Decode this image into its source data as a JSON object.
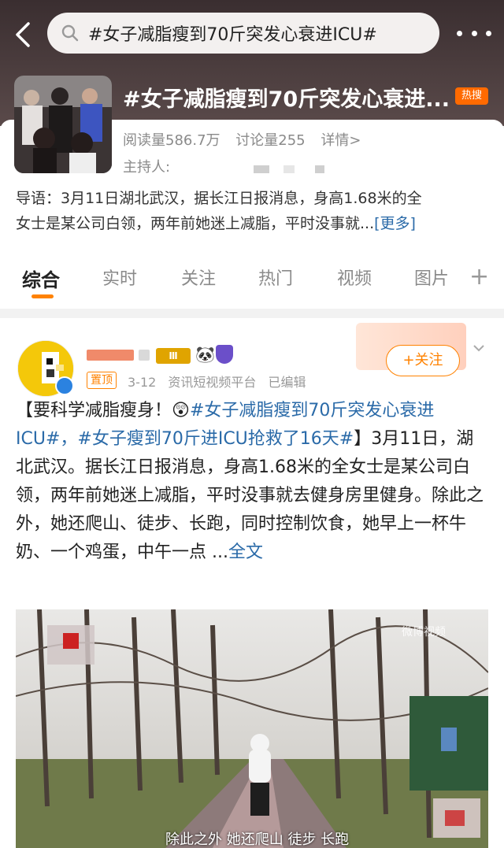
{
  "search": {
    "query": "#女子减脂瘦到70斤突发心衰进ICU#"
  },
  "topic": {
    "title": "#女子减脂瘦到70斤突发心衰进...",
    "hot_badge": "热搜",
    "read_count": "阅读量586.7万",
    "discussion_count": "讨论量255",
    "detail_link": "详情>",
    "host_label": "主持人:",
    "intro_line1": "导语：3月11日湖北武汉，据长江日报消息，身高1.68米的全",
    "intro_line2": "女士是某公司白领，两年前她迷上减脂，平时没事就...",
    "intro_more": "[更多]"
  },
  "tabs": [
    {
      "label": "综合"
    },
    {
      "label": "实时"
    },
    {
      "label": "关注"
    },
    {
      "label": "热门"
    },
    {
      "label": "视频"
    },
    {
      "label": "图片"
    }
  ],
  "post": {
    "level_badge": "Ⅲ",
    "pinned": "置顶",
    "date": "3-12",
    "source": "资讯短视频平台",
    "edited": "已编辑",
    "follow_label": "+关注",
    "text_prefix": "【要科学减脂瘦身！",
    "tag1": "#女子减脂瘦到70斤突发心衰进ICU#",
    "sep": "，",
    "tag2": "#女子瘦到70斤进ICU抢救了16天#",
    "text_body": "】3月11日，湖北武汉。据长江日报消息，身高1.68米的全女士是某公司白领，两年前她迷上减脂，平时没事就去健身房里健身。除此之外，她还爬山、徒步、长跑，同时控制饮食，她早上一杯牛奶、一个鸡蛋，中午一点 ...",
    "full_text": "全文",
    "video_caption": "除此之外 她还爬山 徒步 长跑",
    "watermark": "微博视频"
  },
  "colors": {
    "accent": "#ff8200",
    "link": "#2a6aa8",
    "hot": "#ff6a00"
  }
}
